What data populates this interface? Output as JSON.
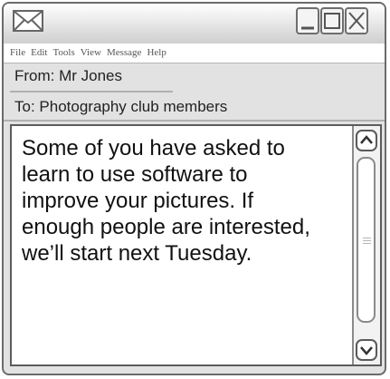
{
  "window": {
    "app_icon": "envelope-icon",
    "controls": [
      "minimize-icon",
      "maximize-icon",
      "close-icon"
    ]
  },
  "menu": [
    "File",
    "Edit",
    "Tools",
    "View",
    "Message",
    "Help"
  ],
  "header": {
    "from": "From: Mr Jones",
    "to": "To: Photography club members"
  },
  "message": {
    "lines": [
      "Some of you have asked to",
      "learn to use software to",
      "improve your pictures. If",
      "enough people are interested,",
      "we’ll start next Tuesday."
    ]
  },
  "scroll": {
    "icons": [
      "chevron-up-icon",
      "chevron-down-icon"
    ]
  }
}
